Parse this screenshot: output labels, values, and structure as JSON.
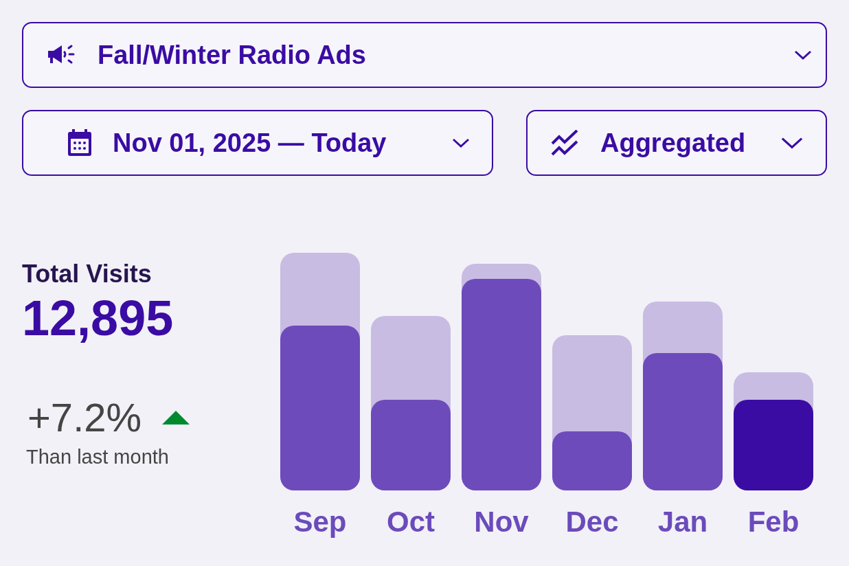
{
  "campaign": {
    "label": "Fall/Winter Radio Ads"
  },
  "date_range": {
    "label": "Nov 01, 2025 — Today"
  },
  "mode": {
    "label": "Aggregated"
  },
  "stat": {
    "title": "Total Visits",
    "value": "12,895",
    "change": "+7.2%",
    "rising": true,
    "caption": "Than last month"
  },
  "months": [
    {
      "label": "Sep",
      "selected": false
    },
    {
      "label": "Oct",
      "selected": false
    },
    {
      "label": "Nov",
      "selected": false
    },
    {
      "label": "Dec",
      "selected": false
    },
    {
      "label": "Jan",
      "selected": false
    },
    {
      "label": "Feb",
      "selected": true
    }
  ]
}
